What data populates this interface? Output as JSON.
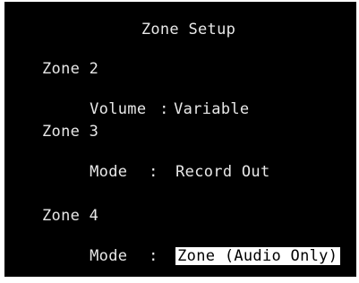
{
  "title": "Zone Setup",
  "zones": [
    {
      "name": "Zone 2",
      "label": "Volume",
      "separator": ":",
      "value": "Variable"
    },
    {
      "name": "Zone 3",
      "label": "Mode",
      "separator": ":",
      "value": "Record Out"
    },
    {
      "name": "Zone 4",
      "label": "Mode",
      "separator": ":",
      "value": "Zone (Audio Only)",
      "selected": true
    }
  ],
  "colors": {
    "background": "#000000",
    "text": "#e8e8e8",
    "highlight_bg": "#ffffff",
    "highlight_text": "#000000"
  }
}
